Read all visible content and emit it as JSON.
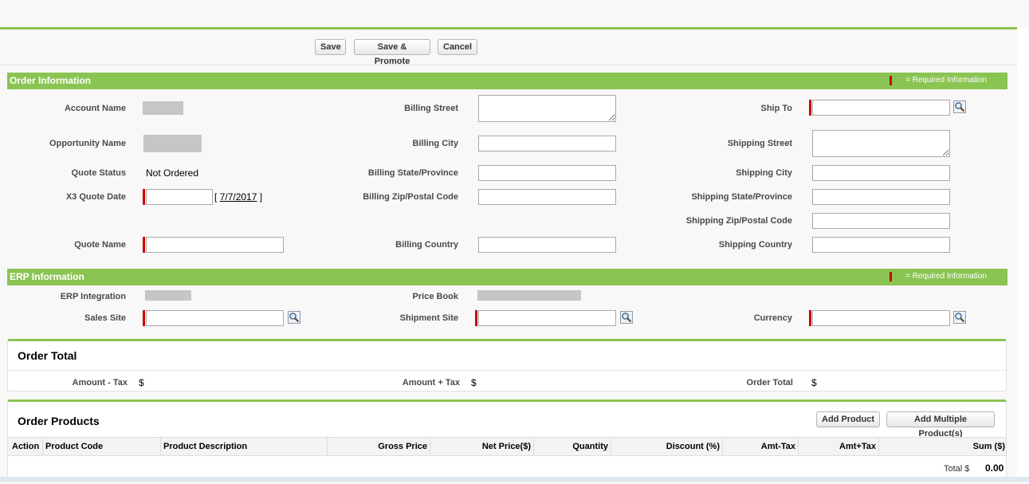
{
  "toolbar": {
    "save": "Save",
    "save_promote": "Save & Promote",
    "cancel": "Cancel"
  },
  "order_info": {
    "title": "Order Information",
    "required_text": "= Required Information",
    "account_name_label": "Account Name",
    "opportunity_name_label": "Opportunity Name",
    "quote_status_label": "Quote Status",
    "quote_status_value": "Not Ordered",
    "x3_quote_date_label": "X3 Quote Date",
    "x3_quote_date_value": "",
    "date_bracket_open": "[",
    "date_link": "7/7/2017",
    "date_bracket_close": "]",
    "quote_name_label": "Quote Name",
    "billing_street_label": "Billing Street",
    "billing_city_label": "Billing City",
    "billing_state_label": "Billing State/Province",
    "billing_zip_label": "Billing Zip/Postal Code",
    "billing_country_label": "Billing Country",
    "ship_to_label": "Ship To",
    "shipping_street_label": "Shipping Street",
    "shipping_city_label": "Shipping City",
    "shipping_state_label": "Shipping State/Province",
    "shipping_zip_label": "Shipping Zip/Postal Code",
    "shipping_country_label": "Shipping Country"
  },
  "erp_info": {
    "title": "ERP Information",
    "required_text": "= Required Information",
    "erp_integration_label": "ERP Integration",
    "sales_site_label": "Sales Site",
    "price_book_label": "Price Book",
    "shipment_site_label": "Shipment Site",
    "currency_label": "Currency"
  },
  "order_total": {
    "title": "Order Total",
    "amount_minus_tax_label": "Amount - Tax",
    "amount_minus_tax_value": "$",
    "amount_plus_tax_label": "Amount + Tax",
    "amount_plus_tax_value": "$",
    "order_total_label": "Order Total",
    "order_total_value": "$"
  },
  "order_products": {
    "title": "Order Products",
    "add_product": "Add Product",
    "add_multiple": "Add Multiple Product(s)",
    "columns": [
      "Action",
      "Product Code",
      "Product Description",
      "Gross Price",
      "Net Price($)",
      "Quantity",
      "Discount (%)",
      "Amt-Tax",
      "Amt+Tax",
      "Sum ($)"
    ],
    "total_label": "Total $",
    "total_value": "0.00"
  },
  "colors": {
    "accent": "#8ac453",
    "required": "#cc0000"
  },
  "icons": {
    "lookup": "magnifier-lookup-icon"
  }
}
